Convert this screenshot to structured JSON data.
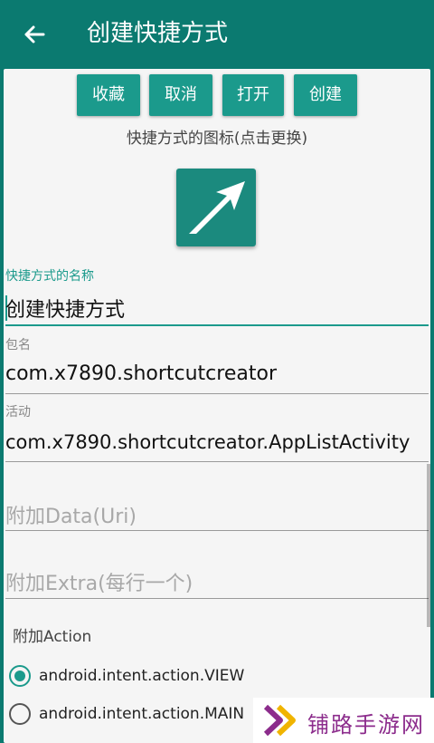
{
  "app_bar": {
    "title": "创建快捷方式",
    "back_icon": "arrow-left-icon"
  },
  "actions": {
    "favorite_label": "收藏",
    "cancel_label": "取消",
    "open_label": "打开",
    "create_label": "创建"
  },
  "icon_section": {
    "caption": "快捷方式的图标(点击更换)",
    "icon": "diagonal-arrow-icon",
    "background_color": "#1b8a7e"
  },
  "fields": {
    "name": {
      "label": "快捷方式的名称",
      "value": "创建快捷方式"
    },
    "package": {
      "label": "包名",
      "value": "com.x7890.shortcutcreator"
    },
    "activity": {
      "label": "活动",
      "value": "com.x7890.shortcutcreator.AppListActivity"
    },
    "data_uri": {
      "placeholder": "附加Data(Uri)"
    },
    "extra": {
      "placeholder": "附加Extra(每行一个)"
    }
  },
  "action_section": {
    "label": "附加Action",
    "options": [
      {
        "label": "android.intent.action.VIEW",
        "checked": true
      },
      {
        "label": "android.intent.action.MAIN",
        "checked": false
      }
    ]
  },
  "watermark": {
    "text": "铺路手游网",
    "logo": "chevron-logo-icon"
  },
  "colors": {
    "primary": "#0b7a70",
    "accent": "#1b9a8c",
    "watermark": "#8c2c8c"
  }
}
